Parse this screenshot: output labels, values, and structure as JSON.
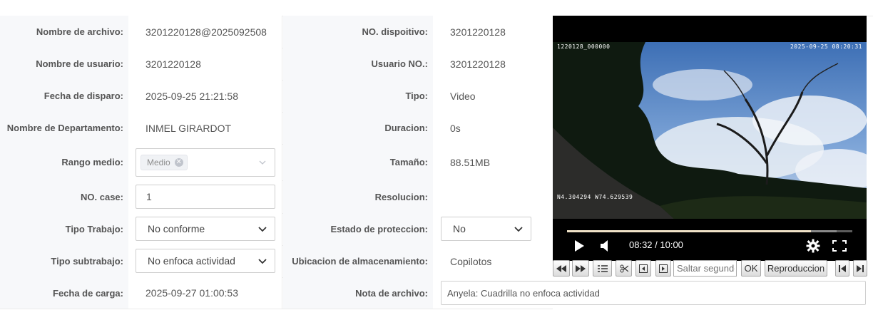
{
  "form": {
    "row1": {
      "label": "Nombre de archivo:",
      "value": "3201220128@2025092508",
      "label2": "NO. dispoitivo:",
      "value2": "3201220128"
    },
    "row2": {
      "label": "Nombre de usuario:",
      "value": "3201220128",
      "label2": "Usuario NO.:",
      "value2": "3201220128"
    },
    "row3": {
      "label": "Fecha de disparo:",
      "value": "2025-09-25 21:21:58",
      "label2": "Tipo:",
      "value2": "Video"
    },
    "row4": {
      "label": "Nombre de Departamento:",
      "value": "INMEL GIRARDOT",
      "label2": "Duracion:",
      "value2": "0s"
    },
    "row5": {
      "label": "Rango medio:",
      "tag": "Medio",
      "label2": "Tamaño:",
      "value2": "88.51MB"
    },
    "row6": {
      "label": "NO. case:",
      "input_value": "1",
      "label2": "Resolucion:",
      "value2": ""
    },
    "row7": {
      "label": "Tipo Trabajo:",
      "select_value": "No conforme",
      "label2": "Estado de proteccion:",
      "select2_value": "No"
    },
    "row8": {
      "label": "Tipo subtrabajo:",
      "select_value": "No enfoca actividad",
      "label2": "Ubicacion de almacenamiento:",
      "value2": "Copilotos"
    },
    "row9": {
      "label": "Fecha de carga:",
      "value": "2025-09-27 01:00:53",
      "label2": "Nota de archivo:",
      "note_value": "Anyela: Cuadrilla no enfoca actividad"
    }
  },
  "video": {
    "osd_top_left": "1220128_000000",
    "osd_top_right": "2025-09-25 08:20:31",
    "osd_coords": "N4.304294  W74.629539",
    "time": "08:32 / 10:00",
    "progress": 0.855,
    "buffered": 0.945
  },
  "toolbar": {
    "seek_placeholder": "Saltar segundos",
    "ok_label": "OK",
    "playback_label": "Reproduccion"
  },
  "icons": [
    "rewind-icon",
    "fast-forward-icon",
    "list-icon",
    "scissors-icon",
    "prev-frame-icon",
    "next-frame-icon",
    "skip-start-icon",
    "skip-end-icon",
    "play-icon",
    "volume-icon",
    "gear-icon",
    "fullscreen-icon",
    "chevron-down-icon",
    "tag-close-icon"
  ]
}
